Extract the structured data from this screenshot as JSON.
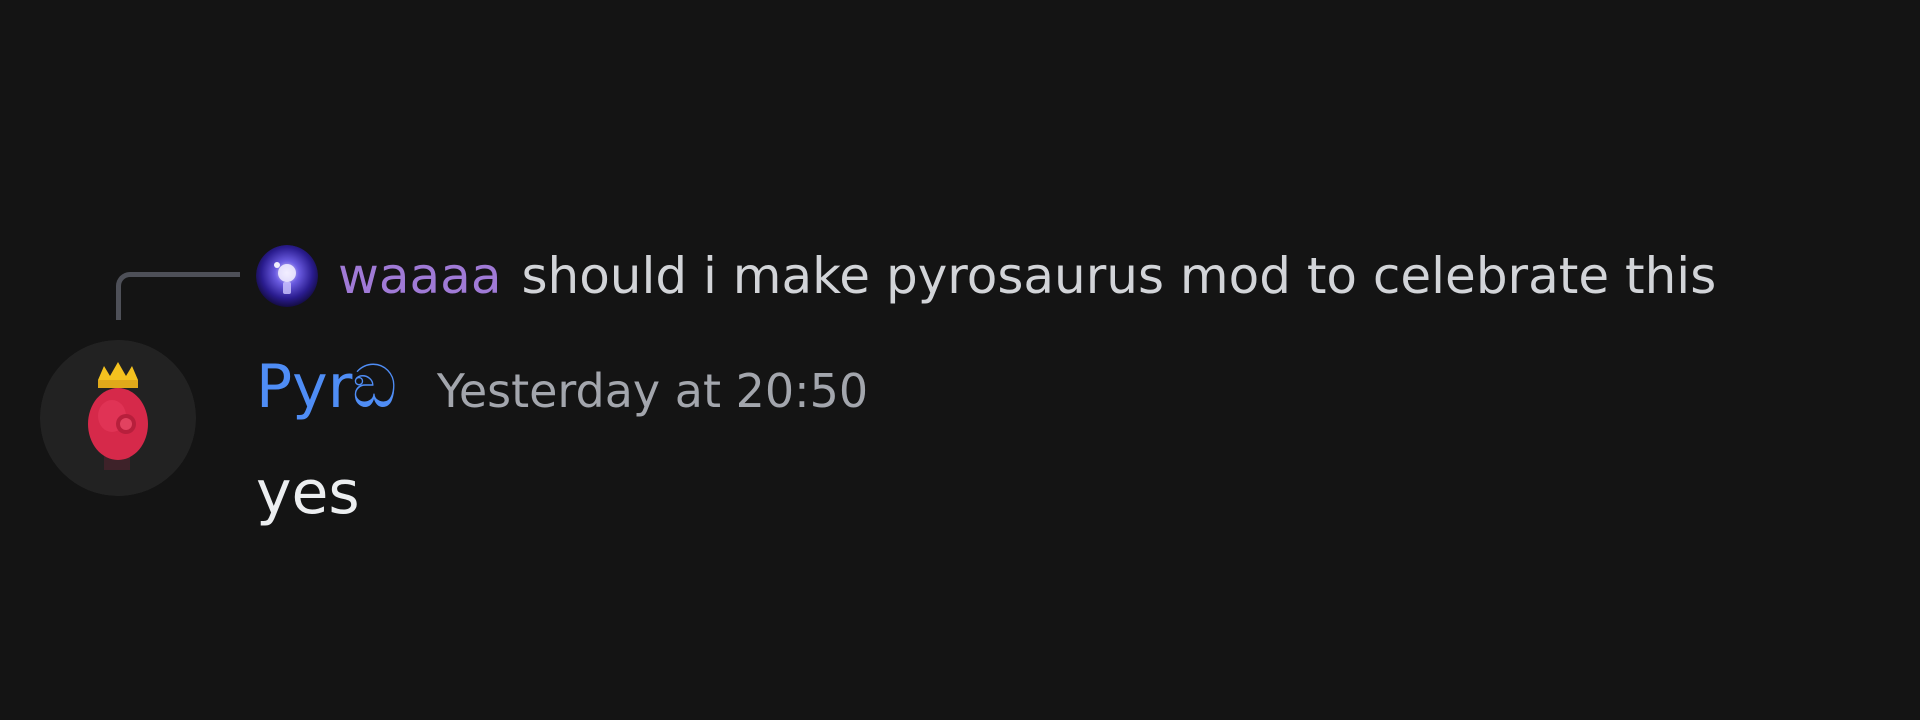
{
  "reply": {
    "author": "waaaa",
    "content": "should i make pyrosaurus mod to celebrate this",
    "author_color": "#a07ad6",
    "avatar_icon": "purple-orb-avatar-icon"
  },
  "message": {
    "author": "Pyrඞ",
    "author_color": "#4f8df5",
    "timestamp": "Yesterday at 20:50",
    "content": "yes",
    "avatar_icon": "red-creature-with-crown-avatar-icon"
  },
  "colors": {
    "background": "#141414",
    "spine": "#4e5058",
    "text": "#eceef0",
    "muted": "#a3a6ad"
  }
}
